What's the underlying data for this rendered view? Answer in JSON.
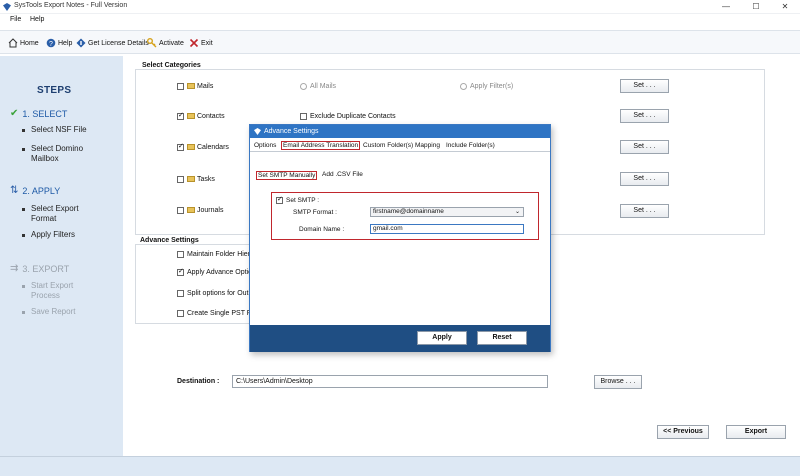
{
  "window": {
    "title": "SysTools Export Notes - Full Version",
    "controls": [
      "—",
      "☐",
      "✕"
    ]
  },
  "menu": [
    "File",
    "Help"
  ],
  "toolbar": {
    "home": "Home",
    "help": "Help",
    "license": "Get License Details",
    "activate": "Activate",
    "exit": "Exit"
  },
  "sidebar": {
    "title": "STEPS",
    "steps": [
      {
        "head": "1. SELECT",
        "subs": [
          "Select NSF File",
          "Select Domino Mailbox"
        ]
      },
      {
        "head": "2. APPLY",
        "subs": [
          "Select Export Format",
          "Apply Filters"
        ]
      },
      {
        "head": "3. EXPORT",
        "subs": [
          "Start Export Process",
          "Save Report"
        ]
      }
    ]
  },
  "categories": {
    "title": "Select Categories",
    "items": [
      {
        "label": "Mails",
        "checked": false
      },
      {
        "label": "Contacts",
        "checked": true
      },
      {
        "label": "Calendars",
        "checked": true
      },
      {
        "label": "Tasks",
        "checked": false
      },
      {
        "label": "Journals",
        "checked": false
      }
    ],
    "all_mails": "All Mails",
    "apply_filters": "Apply Filter(s)",
    "exclude_duplicates": "Exclude Duplicate Contacts",
    "set_button": "Set . . ."
  },
  "advance": {
    "title": "Advance Settings",
    "options": [
      {
        "label": "Maintain Folder Hiera",
        "checked": false
      },
      {
        "label": "Apply Advance Optio",
        "checked": true
      },
      {
        "label": "Split options for Outl",
        "checked": false
      },
      {
        "label": "Create Single PST File",
        "checked": false
      }
    ]
  },
  "destination": {
    "label": "Destination :",
    "value": "C:\\Users\\Admin\\Desktop",
    "browse": "Browse . . ."
  },
  "nav": {
    "previous": "<< Previous",
    "export": "Export"
  },
  "dialog": {
    "title": "Advance Settings",
    "tabs": [
      "Options",
      "Email Address Translation",
      "Custom Folder(s) Mapping",
      "Include Folder(s)"
    ],
    "subtabs": [
      "Set SMTP Manually",
      "Add .CSV File"
    ],
    "set_smtp_label": "Set SMTP :",
    "smtp_format_label": "SMTP Format :",
    "smtp_format_value": "firstname@domainname",
    "domain_label": "Domain Name :",
    "domain_value": "gmail.com",
    "apply": "Apply",
    "reset": "Reset"
  },
  "colors": {
    "accent": "#2e74c4",
    "dialog_footer": "#1f4e83",
    "sidebar_bg": "#dde8f4",
    "highlight": "#c0272d"
  }
}
